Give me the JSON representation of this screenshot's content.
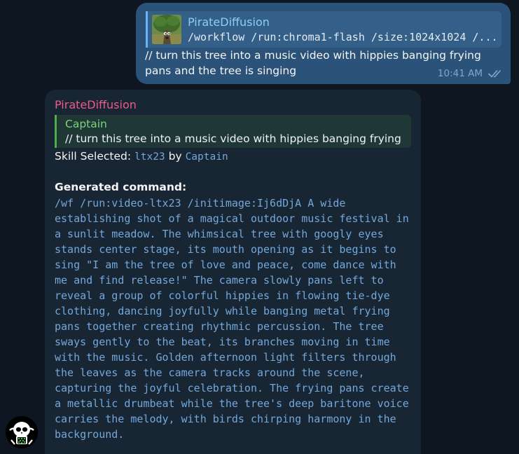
{
  "outgoing": {
    "reply_name": "PirateDiffusion",
    "reply_text": "/workflow /run:chroma1-flash /size:1024x1024 /...",
    "text": "// turn this tree into a music video with hippies banging frying pans and the tree is singing",
    "time": "10:41 AM",
    "status_icon": "double-check-icon",
    "thumbnail_icon": "tree-image-thumbnail"
  },
  "incoming": {
    "sender": "PirateDiffusion",
    "reply_name": "Captain",
    "reply_text": "// turn this tree into a music video with hippies banging frying ...",
    "skill_label": "Skill Selected:",
    "skill_name": "ltx23",
    "skill_by": "by",
    "skill_author": "Captain",
    "generated_label": "Generated command:",
    "generated_command": "/wf /run:video-ltx23 /initimage:Ij6dDjA A wide\nestablishing shot of a magical outdoor music festival in\na sunlit meadow. The whimsical tree with googly eyes\nstands center stage, its mouth opening as it begins to\nsing \"I am the tree of love and peace, come dance with\nme and find release!\" The camera slowly pans left to\nreveal a group of colorful hippies in flowing tie-dye\nclothing, dancing joyfully while banging metal frying\npans together creating rhythmic percussion. The tree\nsways gently to the beat, its branches moving in time\nwith the music. Golden afternoon light filters through\nthe leaves as the camera tracks around the scene,\ncapturing the joyful celebration. The frying pans create\na metallic drumbeat while the tree's deep baritone voice\ncarries the melody, with birds chirping harmony in the\nbackground."
  },
  "avatar_icon": "pirate-skull-avatar",
  "colors": {
    "background": "#0e1621",
    "outgoing_bubble": "#2b5278",
    "incoming_bubble": "#182533",
    "sender_name": "#ee5a89",
    "reply_accent_green": "#4fae4e",
    "link_blue": "#73a8dc"
  }
}
